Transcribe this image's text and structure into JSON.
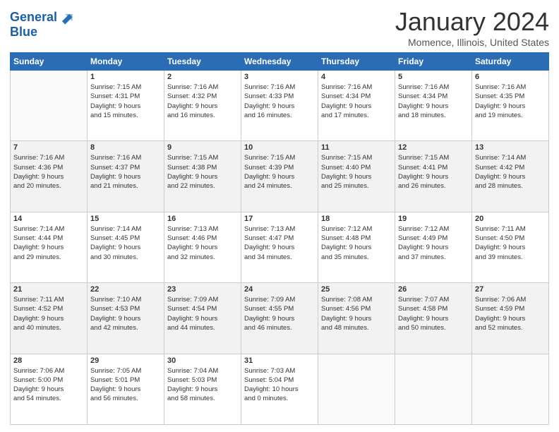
{
  "header": {
    "logo_line1": "General",
    "logo_line2": "Blue",
    "month": "January 2024",
    "location": "Momence, Illinois, United States"
  },
  "days_header": [
    "Sunday",
    "Monday",
    "Tuesday",
    "Wednesday",
    "Thursday",
    "Friday",
    "Saturday"
  ],
  "weeks": [
    [
      {
        "day": "",
        "data": ""
      },
      {
        "day": "1",
        "data": "Sunrise: 7:15 AM\nSunset: 4:31 PM\nDaylight: 9 hours\nand 15 minutes."
      },
      {
        "day": "2",
        "data": "Sunrise: 7:16 AM\nSunset: 4:32 PM\nDaylight: 9 hours\nand 16 minutes."
      },
      {
        "day": "3",
        "data": "Sunrise: 7:16 AM\nSunset: 4:33 PM\nDaylight: 9 hours\nand 16 minutes."
      },
      {
        "day": "4",
        "data": "Sunrise: 7:16 AM\nSunset: 4:34 PM\nDaylight: 9 hours\nand 17 minutes."
      },
      {
        "day": "5",
        "data": "Sunrise: 7:16 AM\nSunset: 4:34 PM\nDaylight: 9 hours\nand 18 minutes."
      },
      {
        "day": "6",
        "data": "Sunrise: 7:16 AM\nSunset: 4:35 PM\nDaylight: 9 hours\nand 19 minutes."
      }
    ],
    [
      {
        "day": "7",
        "data": "Sunrise: 7:16 AM\nSunset: 4:36 PM\nDaylight: 9 hours\nand 20 minutes."
      },
      {
        "day": "8",
        "data": "Sunrise: 7:16 AM\nSunset: 4:37 PM\nDaylight: 9 hours\nand 21 minutes."
      },
      {
        "day": "9",
        "data": "Sunrise: 7:15 AM\nSunset: 4:38 PM\nDaylight: 9 hours\nand 22 minutes."
      },
      {
        "day": "10",
        "data": "Sunrise: 7:15 AM\nSunset: 4:39 PM\nDaylight: 9 hours\nand 24 minutes."
      },
      {
        "day": "11",
        "data": "Sunrise: 7:15 AM\nSunset: 4:40 PM\nDaylight: 9 hours\nand 25 minutes."
      },
      {
        "day": "12",
        "data": "Sunrise: 7:15 AM\nSunset: 4:41 PM\nDaylight: 9 hours\nand 26 minutes."
      },
      {
        "day": "13",
        "data": "Sunrise: 7:14 AM\nSunset: 4:42 PM\nDaylight: 9 hours\nand 28 minutes."
      }
    ],
    [
      {
        "day": "14",
        "data": "Sunrise: 7:14 AM\nSunset: 4:44 PM\nDaylight: 9 hours\nand 29 minutes."
      },
      {
        "day": "15",
        "data": "Sunrise: 7:14 AM\nSunset: 4:45 PM\nDaylight: 9 hours\nand 30 minutes."
      },
      {
        "day": "16",
        "data": "Sunrise: 7:13 AM\nSunset: 4:46 PM\nDaylight: 9 hours\nand 32 minutes."
      },
      {
        "day": "17",
        "data": "Sunrise: 7:13 AM\nSunset: 4:47 PM\nDaylight: 9 hours\nand 34 minutes."
      },
      {
        "day": "18",
        "data": "Sunrise: 7:12 AM\nSunset: 4:48 PM\nDaylight: 9 hours\nand 35 minutes."
      },
      {
        "day": "19",
        "data": "Sunrise: 7:12 AM\nSunset: 4:49 PM\nDaylight: 9 hours\nand 37 minutes."
      },
      {
        "day": "20",
        "data": "Sunrise: 7:11 AM\nSunset: 4:50 PM\nDaylight: 9 hours\nand 39 minutes."
      }
    ],
    [
      {
        "day": "21",
        "data": "Sunrise: 7:11 AM\nSunset: 4:52 PM\nDaylight: 9 hours\nand 40 minutes."
      },
      {
        "day": "22",
        "data": "Sunrise: 7:10 AM\nSunset: 4:53 PM\nDaylight: 9 hours\nand 42 minutes."
      },
      {
        "day": "23",
        "data": "Sunrise: 7:09 AM\nSunset: 4:54 PM\nDaylight: 9 hours\nand 44 minutes."
      },
      {
        "day": "24",
        "data": "Sunrise: 7:09 AM\nSunset: 4:55 PM\nDaylight: 9 hours\nand 46 minutes."
      },
      {
        "day": "25",
        "data": "Sunrise: 7:08 AM\nSunset: 4:56 PM\nDaylight: 9 hours\nand 48 minutes."
      },
      {
        "day": "26",
        "data": "Sunrise: 7:07 AM\nSunset: 4:58 PM\nDaylight: 9 hours\nand 50 minutes."
      },
      {
        "day": "27",
        "data": "Sunrise: 7:06 AM\nSunset: 4:59 PM\nDaylight: 9 hours\nand 52 minutes."
      }
    ],
    [
      {
        "day": "28",
        "data": "Sunrise: 7:06 AM\nSunset: 5:00 PM\nDaylight: 9 hours\nand 54 minutes."
      },
      {
        "day": "29",
        "data": "Sunrise: 7:05 AM\nSunset: 5:01 PM\nDaylight: 9 hours\nand 56 minutes."
      },
      {
        "day": "30",
        "data": "Sunrise: 7:04 AM\nSunset: 5:03 PM\nDaylight: 9 hours\nand 58 minutes."
      },
      {
        "day": "31",
        "data": "Sunrise: 7:03 AM\nSunset: 5:04 PM\nDaylight: 10 hours\nand 0 minutes."
      },
      {
        "day": "",
        "data": ""
      },
      {
        "day": "",
        "data": ""
      },
      {
        "day": "",
        "data": ""
      }
    ]
  ]
}
